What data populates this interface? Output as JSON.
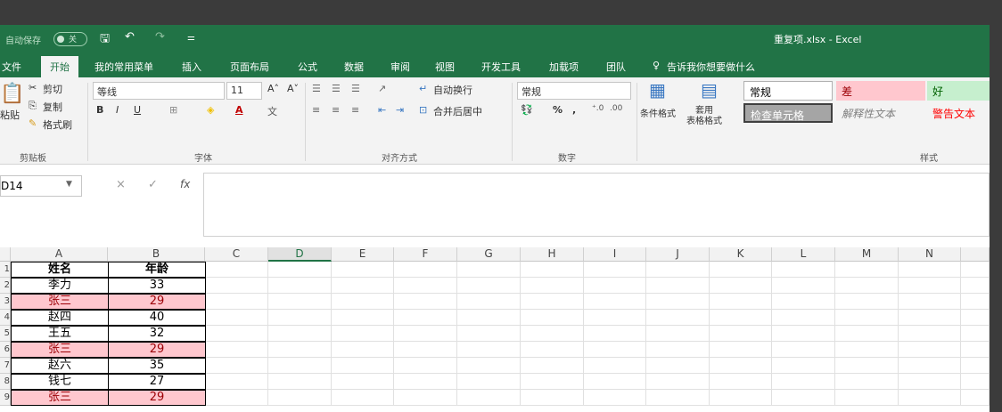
{
  "titlebar": {
    "autosave_label": "自动保存",
    "autosave_state": "关",
    "title": "重复项.xlsx  -  Excel"
  },
  "tabs": [
    "文件",
    "开始",
    "我的常用菜单",
    "插入",
    "页面布局",
    "公式",
    "数据",
    "审阅",
    "视图",
    "开发工具",
    "加载项",
    "团队"
  ],
  "active_tab": "开始",
  "tell_me": "告诉我你想要做什么",
  "ribbon": {
    "clipboard": {
      "paste": "粘贴",
      "cut": "剪切",
      "copy": "复制",
      "format_painter": "格式刷",
      "label": "剪贴板"
    },
    "font": {
      "name": "等线",
      "size": "11",
      "bold": "B",
      "italic": "I",
      "underline": "U",
      "grow": "A˄",
      "shrink": "A˅",
      "label": "字体"
    },
    "alignment": {
      "wrap": "自动换行",
      "merge": "合并后居中",
      "label": "对齐方式"
    },
    "number": {
      "format": "常规",
      "percent": "%",
      "comma": ",",
      "label": "数字"
    },
    "styles": {
      "conditional": "条件格式",
      "table": "套用\n表格格式",
      "cells": [
        {
          "text": "常规",
          "bg": "#ffffff",
          "color": "#000000"
        },
        {
          "text": "差",
          "bg": "#ffc7ce",
          "color": "#9c0006"
        },
        {
          "text": "好",
          "bg": "#c6efce",
          "color": "#006100"
        },
        {
          "text": "检查单元格",
          "bg": "#a5a5a5",
          "color": "#ffffff"
        },
        {
          "text": "解释性文本",
          "bg": "#f3f3f3",
          "color": "#7f7f7f"
        },
        {
          "text": "警告文本",
          "bg": "#f3f3f3",
          "color": "#ff0000"
        }
      ],
      "label": "样式"
    }
  },
  "formula_bar": {
    "name_box": "D14",
    "fx": "fx",
    "cancel": "×",
    "enter": "✓",
    "value": ""
  },
  "columns": [
    "A",
    "B",
    "C",
    "D",
    "E",
    "F",
    "G",
    "H",
    "I",
    "J",
    "K",
    "L",
    "M",
    "N"
  ],
  "selected_column": "D",
  "rows": [
    {
      "num": "1",
      "name": "姓名",
      "age": "年龄",
      "header": true,
      "dup": false
    },
    {
      "num": "2",
      "name": "李力",
      "age": "33",
      "header": false,
      "dup": false
    },
    {
      "num": "3",
      "name": "张三",
      "age": "29",
      "header": false,
      "dup": true
    },
    {
      "num": "4",
      "name": "赵四",
      "age": "40",
      "header": false,
      "dup": false
    },
    {
      "num": "5",
      "name": "王五",
      "age": "32",
      "header": false,
      "dup": false
    },
    {
      "num": "6",
      "name": "张三",
      "age": "29",
      "header": false,
      "dup": true
    },
    {
      "num": "7",
      "name": "赵六",
      "age": "35",
      "header": false,
      "dup": false
    },
    {
      "num": "8",
      "name": "钱七",
      "age": "27",
      "header": false,
      "dup": false
    },
    {
      "num": "9",
      "name": "张三",
      "age": "29",
      "header": false,
      "dup": true
    }
  ],
  "colors": {
    "brand": "#217346",
    "duplicate_fill": "#ffc7ce",
    "duplicate_text": "#9c0006"
  }
}
